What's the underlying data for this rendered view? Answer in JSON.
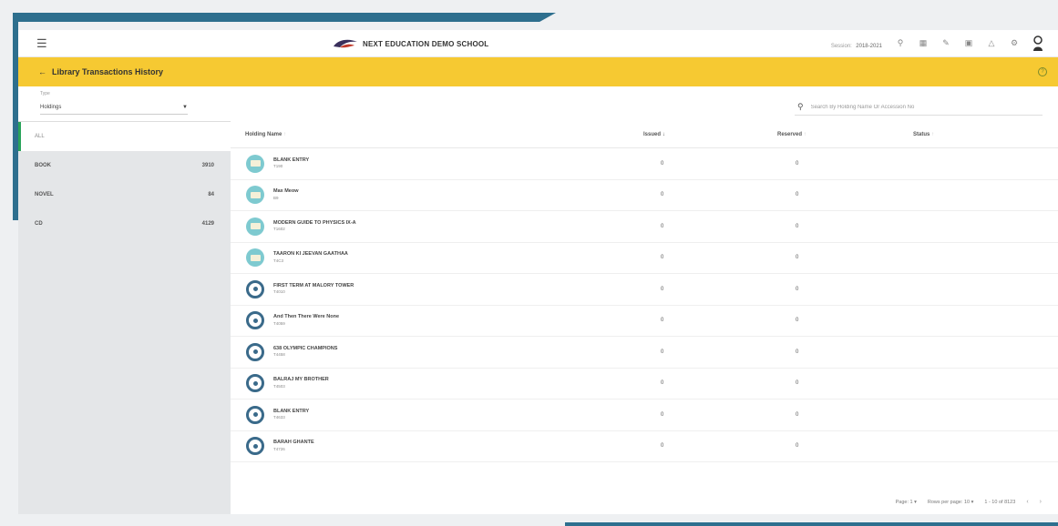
{
  "header": {
    "school_name": "NEXT EDUCATION DEMO SCHOOL",
    "session_label": "Session:",
    "session_value": "2018-2021"
  },
  "page": {
    "title": "Library Transactions History"
  },
  "filter": {
    "type_label": "Type",
    "type_value": "Holdings",
    "search_placeholder": "Search By Holding Name Or Accession No"
  },
  "sidebar": {
    "items": [
      {
        "label": "ALL",
        "count": ""
      },
      {
        "label": "BOOK",
        "count": "3910"
      },
      {
        "label": "NOVEL",
        "count": "84"
      },
      {
        "label": "CD",
        "count": "4129"
      }
    ]
  },
  "table": {
    "headers": {
      "name": "Holding Name",
      "issued": "Issued",
      "reserved": "Reserved",
      "status": "Status"
    },
    "rows": [
      {
        "title": "BLANK ENTRY",
        "accession": "T190",
        "issued": "0",
        "reserved": "0",
        "type": "book"
      },
      {
        "title": "Max Meow",
        "accession": "B9",
        "issued": "0",
        "reserved": "0",
        "type": "book"
      },
      {
        "title": "MODERN GUIDE TO PHYSICS IX-A",
        "accession": "T1602",
        "issued": "0",
        "reserved": "0",
        "type": "book"
      },
      {
        "title": "TAARON KI JEEVAN GAATHAA",
        "accession": "T4C3",
        "issued": "0",
        "reserved": "0",
        "type": "book"
      },
      {
        "title": "FIRST TERM AT MALORY TOWER",
        "accession": "T4010",
        "issued": "0",
        "reserved": "0",
        "type": "cd"
      },
      {
        "title": "And Then There Were None",
        "accession": "T4059",
        "issued": "0",
        "reserved": "0",
        "type": "cd"
      },
      {
        "title": "638 OLYMPIC CHAMPIONS",
        "accession": "T4458",
        "issued": "0",
        "reserved": "0",
        "type": "cd"
      },
      {
        "title": "BALRAJ MY BROTHER",
        "accession": "T4503",
        "issued": "0",
        "reserved": "0",
        "type": "cd"
      },
      {
        "title": "BLANK ENTRY",
        "accession": "T4633",
        "issued": "0",
        "reserved": "0",
        "type": "cd"
      },
      {
        "title": "BARAH GHANTE",
        "accession": "T4726",
        "issued": "0",
        "reserved": "0",
        "type": "cd"
      }
    ]
  },
  "pagination": {
    "page_label": "Page:",
    "page_value": "1",
    "rows_label": "Rows per page:",
    "rows_value": "10",
    "range": "1 - 10 of 8123"
  },
  "colors": {
    "accent_yellow": "#f6c932",
    "decor_blue": "#2e6f8e",
    "active_green": "#29a35a"
  },
  "icons": [
    "menu-icon",
    "search-icon",
    "calendar-icon",
    "edit-icon",
    "calendar-icon",
    "bell-icon",
    "gear-icon",
    "avatar-icon",
    "back-arrow-icon",
    "help-icon"
  ]
}
